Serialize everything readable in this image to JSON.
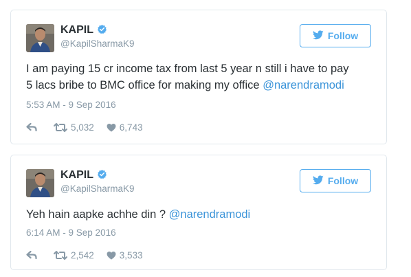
{
  "tweets": [
    {
      "name": "KAPIL",
      "handle": "@KapilSharmaK9",
      "follow_label": "Follow",
      "text_line1": "I am paying 15 cr income tax from last 5 year n still i have to pay",
      "text_line2": "5 lacs bribe to BMC office for making my office ",
      "mention": "@narendramodi",
      "timestamp": "5:53 AM - 9 Sep 2016",
      "retweets": "5,032",
      "likes": "6,743"
    },
    {
      "name": "KAPIL",
      "handle": "@KapilSharmaK9",
      "follow_label": "Follow",
      "text": "Yeh hain aapke achhe din ? ",
      "mention": "@narendramodi",
      "timestamp": "6:14 AM - 9 Sep 2016",
      "retweets": "2,542",
      "likes": "3,533"
    }
  ],
  "colors": {
    "twitter_blue": "#55acee",
    "mention_blue": "#3b94d9",
    "muted_gray": "#8899a6",
    "text_dark": "#292f33",
    "card_border": "#e1e8ed"
  },
  "icons": [
    "verified-badge-icon",
    "twitter-bird-icon",
    "reply-icon",
    "retweet-icon",
    "heart-icon"
  ]
}
